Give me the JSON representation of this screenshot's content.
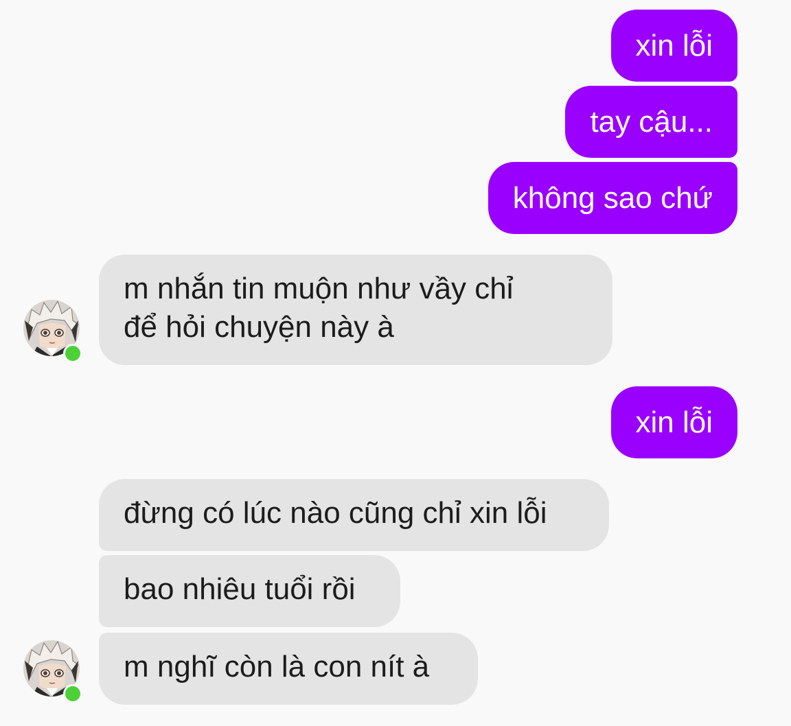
{
  "colors": {
    "background": "#f9f9f9",
    "sent_bubble": "#9a00fe",
    "received_bubble": "#e4e4e4",
    "online_indicator": "#4cd137"
  },
  "messages": [
    {
      "direction": "sent",
      "text": "xin lỗi"
    },
    {
      "direction": "sent",
      "text": "tay cậu..."
    },
    {
      "direction": "sent",
      "text": "không sao chứ"
    },
    {
      "direction": "received",
      "lines": [
        "m nhắn tin muộn như vầy chỉ",
        "để hỏi chuyện này à"
      ]
    },
    {
      "direction": "sent",
      "text": "xin lỗi"
    },
    {
      "direction": "received",
      "text": "đừng có lúc nào cũng chỉ xin lỗi"
    },
    {
      "direction": "received",
      "text": "bao nhiêu tuổi rồi"
    },
    {
      "direction": "received",
      "text": "m nghĩ còn là con nít à"
    }
  ],
  "contact": {
    "avatar_icon": "anime-character-avatar-icon",
    "status_icon": "online-status-dot-icon"
  }
}
